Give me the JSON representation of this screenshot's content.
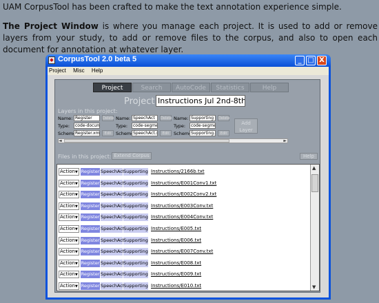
{
  "intro": {
    "line1": "UAM CorpusTool has been crafted to make the text annotation experience simple.",
    "heading": "The Project Window",
    "body": " is where you manage each project. It is used to add or remove layers from your study, to add or remove files to the corpus, and also to open each document for annotation at whatever layer."
  },
  "window": {
    "title": "CorpusTool 2.0 beta 5",
    "menu": [
      "Project",
      "Misc",
      "Help"
    ],
    "controls": {
      "minimize": "_",
      "maximize": "□",
      "close": "X"
    }
  },
  "tabs": [
    "Project",
    "Search",
    "AutoCode",
    "Statistics",
    "Help"
  ],
  "project": {
    "label": "Project:",
    "value": "Instructions Jul 2nd-8th"
  },
  "layers": {
    "heading": "Layers in this project:",
    "labels": {
      "name": "Name:",
      "type": "Type:",
      "scheme": "Scheme:"
    },
    "items": [
      {
        "name": "Register",
        "type": "code-documen",
        "scheme": "Register.xml"
      },
      {
        "name": "SpeechAct",
        "type": "code-segment",
        "scheme": "SpeechAct.xm"
      },
      {
        "name": "Supporting",
        "type": "code-segment",
        "scheme": "Supporting.xm"
      }
    ],
    "side_buttons": [
      "Delete",
      "Edit"
    ],
    "add_layer": "Add Layer"
  },
  "files": {
    "heading": "Files in this project:",
    "extend_button": "Extend Corpus",
    "help_button": "Help",
    "action_label": "Action",
    "chips": [
      "Register",
      "SpeechAct",
      "Supporting"
    ],
    "rows": [
      "Instructions/2166b.txt",
      "Instructions/E001Conv1.txt",
      "Instructions/E002Conv2.txt",
      "Instructions/E003Conv.txt",
      "Instructions/E004Conv.txt",
      "Instructions/E005.txt",
      "Instructions/E006.txt",
      "Instructions/E007Conv.txt",
      "Instructions/E008.txt",
      "Instructions/E009.txt",
      "Instructions/E010.txt"
    ]
  },
  "colors": {
    "window_blue": "#0A52DD",
    "app_gray": "#98A0AA",
    "register_chip": "#7F86E0",
    "layer_chip": "#C9CCF0"
  }
}
